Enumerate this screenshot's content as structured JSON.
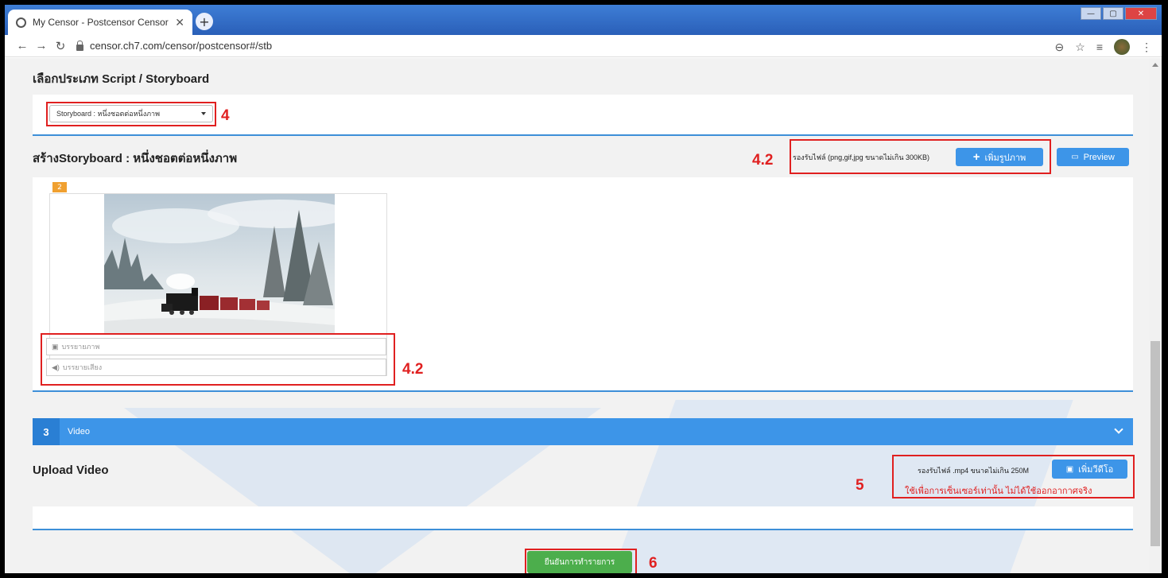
{
  "browser": {
    "tab_title": "My Censor - Postcensor Censor",
    "tab_close": "✕",
    "new_tab": "+",
    "url": "censor.ch7.com/censor/postcensor#/stb",
    "win_min": "—",
    "win_max": "▢",
    "win_close": "✕"
  },
  "script_section": {
    "title": "เลือกประเภท Script / Storyboard",
    "select_value": "Storyboard : หนึ่งชอตต่อหนึ่งภาพ",
    "marker": "4"
  },
  "storyboard_section": {
    "title": "สร้างStoryboard : หนึ่งชอตต่อหนึ่งภาพ",
    "marker_top": "4.2",
    "file_note": "รองรับไฟล์ (png,gif,jpg ขนาดไม่เกิน 300KB)",
    "add_image_label": "เพิ่มรูปภาพ",
    "preview_label": "Preview",
    "frame_number": "2",
    "image_caption_placeholder": "บรรยายภาพ",
    "audio_caption_placeholder": "บรรยายเสียง",
    "marker_fields": "4.2"
  },
  "video_section": {
    "step_number": "3",
    "bar_label": "Video",
    "title": "Upload Video",
    "file_note": "รองรับไฟล์ .mp4 ขนาดไม่เกิน 250M",
    "add_video_label": "เพิ่มวีดีโอ",
    "warning": "ใช้เพื่อการเซ็นเซอร์เท่านั้น ไม่ได้ใช้ออกอากาศจริง",
    "marker": "5"
  },
  "submit": {
    "label": "ยืนยันการทำรายการ",
    "marker": "6"
  },
  "colors": {
    "primary": "#3d95e8",
    "success": "#4cae4c",
    "annotation": "#e02020",
    "badge": "#f0a030"
  }
}
